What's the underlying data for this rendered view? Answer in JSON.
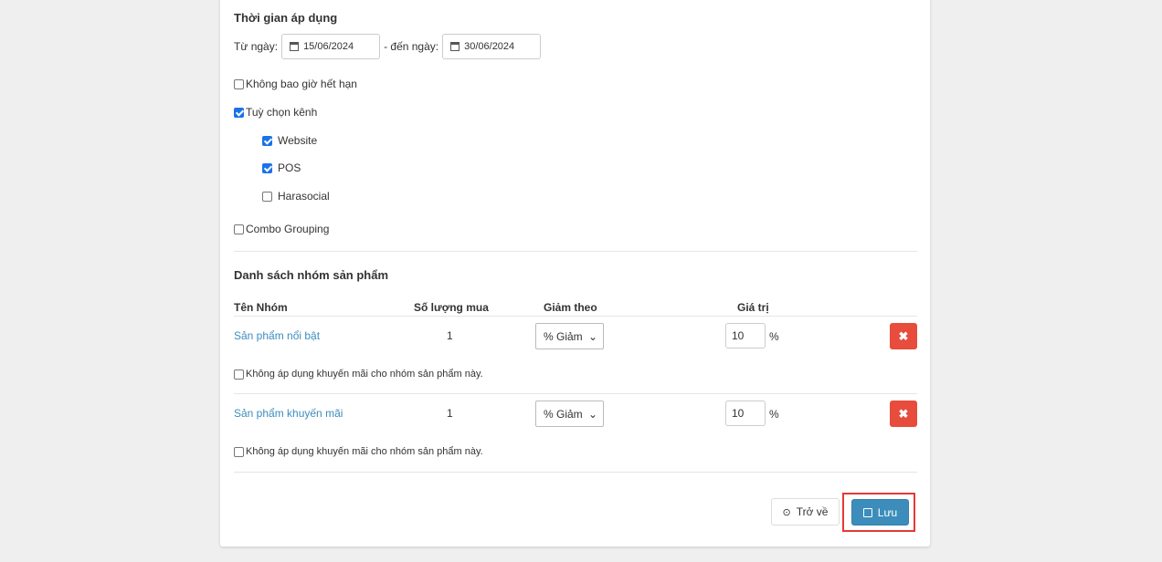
{
  "time": {
    "title": "Thời gian áp dụng",
    "from_label": "Từ ngày:",
    "from_value": "15/06/2024",
    "to_label": "- đến ngày:",
    "to_value": "30/06/2024"
  },
  "options": {
    "never_expire": "Không bao giờ hết hạn",
    "channel_option": "Tuỳ chọn kênh",
    "channels": [
      {
        "label": "Website",
        "checked": true
      },
      {
        "label": "POS",
        "checked": true
      },
      {
        "label": "Harasocial",
        "checked": false
      }
    ],
    "combo_grouping": "Combo Grouping"
  },
  "groups": {
    "title": "Danh sách nhóm sản phẩm",
    "headers": [
      "Tên Nhóm",
      "Số lượng mua",
      "Giảm theo",
      "Giá trị"
    ],
    "rows": [
      {
        "name": "Sản phẩm nổi bật",
        "qty": "1",
        "type": "% Giảm",
        "value": "10",
        "unit": "%",
        "exclude": "Không áp dụng khuyến mãi cho nhóm sản phẩm này."
      },
      {
        "name": "Sản phẩm khuyến mãi",
        "qty": "1",
        "type": "% Giảm",
        "value": "10",
        "unit": "%",
        "exclude": "Không áp dụng khuyến mãi cho nhóm sản phẩm này."
      }
    ]
  },
  "actions": {
    "back": "Trở về",
    "save": "Lưu"
  },
  "colors": {
    "primary": "#3c8dbc",
    "danger": "#e74c3c",
    "highlight": "#e53935"
  }
}
